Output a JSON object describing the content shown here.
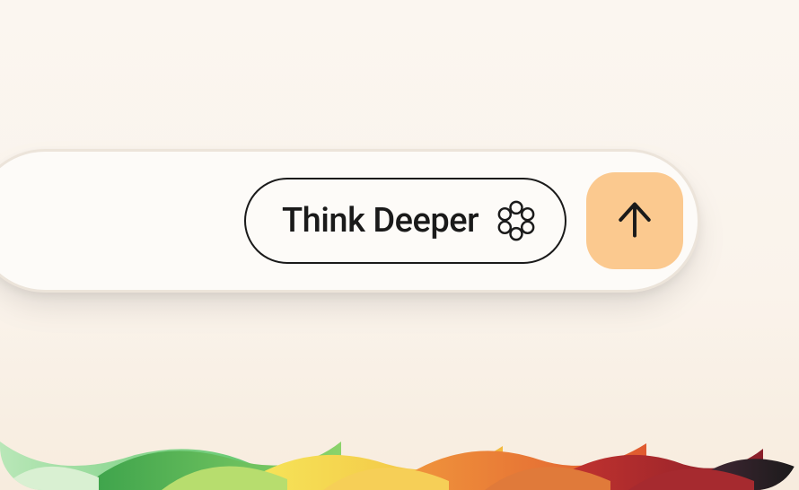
{
  "input_bar": {
    "think_deeper_label": "Think Deeper"
  },
  "icons": {
    "flower": "copilot-flower-icon",
    "arrow_up": "arrow-up-icon"
  },
  "colors": {
    "submit_bg": "#fbc98f",
    "pill_border": "#1a1a1a",
    "bar_bg": "#fdfbf8"
  }
}
